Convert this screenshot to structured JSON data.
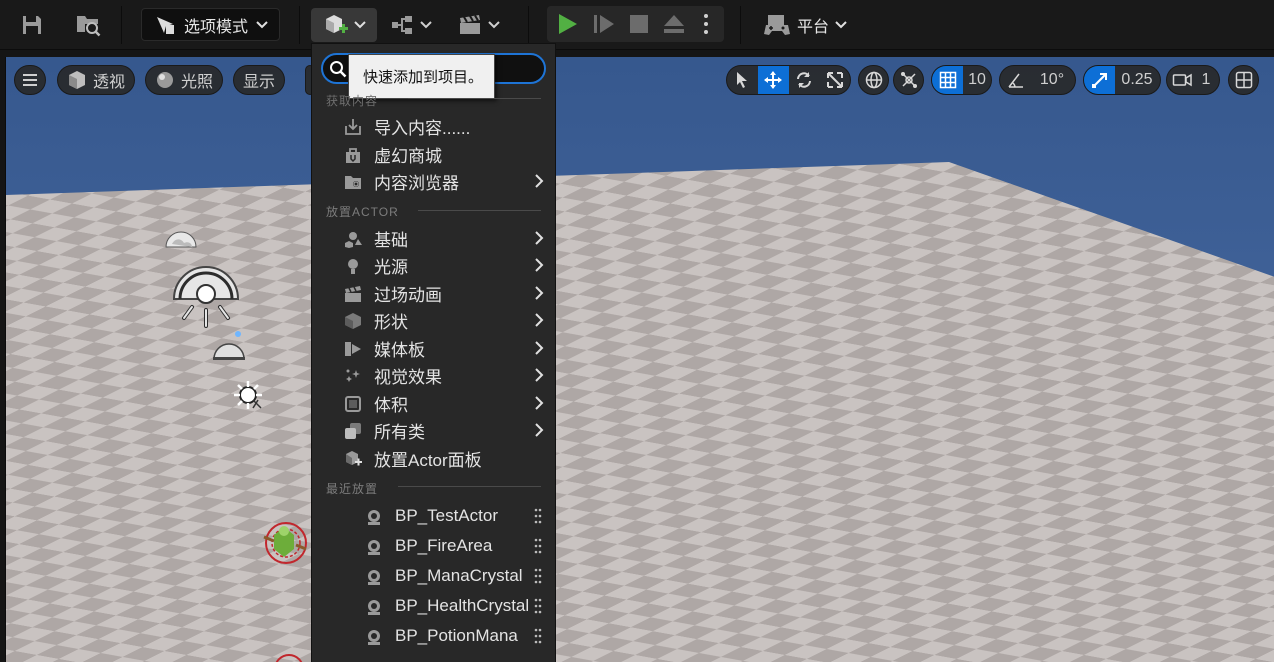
{
  "toolbar": {
    "mode_label": "选项模式",
    "platform_label": "平台"
  },
  "viewport": {
    "menu_icon": "hamburger-icon",
    "perspective_label": "透视",
    "lighting_label": "光照",
    "show_label": "显示",
    "grid_snap_value": "10",
    "rotation_snap_value": "10°",
    "scale_snap_value": "0.25",
    "camera_speed_value": "1"
  },
  "quick_add": {
    "search_placeholder": "",
    "tooltip": "快速添加到项目。",
    "section_get_content": "获取内容",
    "get_content_items": [
      {
        "label": "导入内容......",
        "icon": "import-icon",
        "submenu": false
      },
      {
        "label": "虚幻商城",
        "icon": "marketplace-icon",
        "submenu": false
      },
      {
        "label": "内容浏览器",
        "icon": "content-browser-icon",
        "submenu": true
      }
    ],
    "section_place_actor": "放置ACTOR",
    "place_actor_items": [
      {
        "label": "基础",
        "icon": "basic-icon",
        "submenu": true
      },
      {
        "label": "光源",
        "icon": "light-icon",
        "submenu": true
      },
      {
        "label": "过场动画",
        "icon": "cinematics-icon",
        "submenu": true
      },
      {
        "label": "形状",
        "icon": "shape-icon",
        "submenu": true
      },
      {
        "label": "媒体板",
        "icon": "media-icon",
        "submenu": true
      },
      {
        "label": "视觉效果",
        "icon": "visual-effects-icon",
        "submenu": true
      },
      {
        "label": "体积",
        "icon": "volume-icon",
        "submenu": true
      },
      {
        "label": "所有类",
        "icon": "all-classes-icon",
        "submenu": true
      },
      {
        "label": "放置Actor面板",
        "icon": "place-actors-panel-icon",
        "submenu": false
      }
    ],
    "section_recent": "最近放置",
    "recent_items": [
      {
        "label": "BP_TestActor"
      },
      {
        "label": "BP_FireArea"
      },
      {
        "label": "BP_ManaCrystal"
      },
      {
        "label": "BP_HealthCrystal"
      },
      {
        "label": "BP_PotionMana"
      }
    ]
  },
  "colors": {
    "accent": "#0d6fd6",
    "play_green": "#52b043",
    "sky": "#3c5f96",
    "floor_light": "#c7c0be",
    "floor_dark": "#a79f9d"
  }
}
